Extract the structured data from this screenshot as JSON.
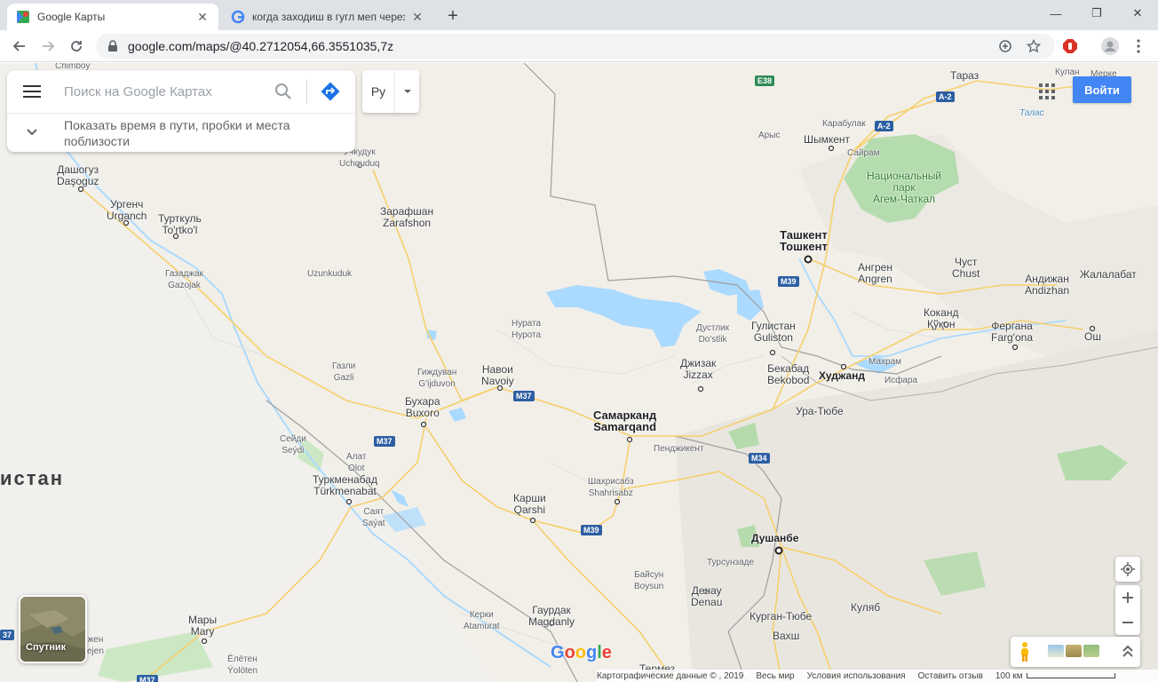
{
  "browser": {
    "tabs": [
      {
        "title": "Google Карты",
        "active": true
      },
      {
        "title": "когда заходиш в гугл меп через",
        "active": false
      }
    ],
    "new_tab": "+",
    "url": "google.com/maps/@40.2712054,66.3551035,7z",
    "window_controls": {
      "minimize": "—",
      "restore": "❐",
      "close": "✕"
    }
  },
  "search": {
    "placeholder": "Поиск на Google Картах",
    "nearby_text": "Показать время в пути, пробки и места поблизости"
  },
  "language": {
    "label": "Ру"
  },
  "header": {
    "signin": "Войти"
  },
  "satellite": {
    "label": "Спутник"
  },
  "logo": "Google",
  "footer": {
    "map_data": "Картографические данные ©  , 2019",
    "world": "Весь мир",
    "terms": "Условия использования",
    "feedback": "Оставить отзыв",
    "scale": "100 км"
  },
  "map": {
    "country_partial": "истан",
    "cities": [
      {
        "name": "Chimboy",
        "lines": [
          "Chimboy"
        ]
      },
      {
        "name": "Dashoguz",
        "lines": [
          "Дашогуз",
          "Daşoguz"
        ]
      },
      {
        "name": "Urgench",
        "lines": [
          "Ургенч",
          "Urganch"
        ]
      },
      {
        "name": "Turtkul",
        "lines": [
          "Турткуль",
          "To'rtko'l"
        ]
      },
      {
        "name": "Gazojak",
        "lines": [
          "Газаджак",
          "Gazojak"
        ]
      },
      {
        "name": "Uchquduq",
        "lines": [
          "Учкудук",
          "Uchquduq"
        ]
      },
      {
        "name": "Zarafshon",
        "lines": [
          "Зарафшан",
          "Zarafshon"
        ]
      },
      {
        "name": "Uzunkuduk",
        "lines": [
          "Uzunkuduk"
        ]
      },
      {
        "name": "Nurota",
        "lines": [
          "Нурата",
          "Нурота"
        ]
      },
      {
        "name": "Gazli",
        "lines": [
          "Газли",
          "Gazli"
        ]
      },
      {
        "name": "Gijduvan",
        "lines": [
          "Гиждуван",
          "G'ijduvon"
        ]
      },
      {
        "name": "Navoiy",
        "lines": [
          "Навои",
          "Navoiy"
        ]
      },
      {
        "name": "Bukhara",
        "lines": [
          "Бухара",
          "Buxoro"
        ]
      },
      {
        "name": "Seydi",
        "lines": [
          "Сейди",
          "Seýdi"
        ]
      },
      {
        "name": "Olot",
        "lines": [
          "Алат",
          "Olot"
        ]
      },
      {
        "name": "Turkmenabat",
        "lines": [
          "Туркменабад",
          "Türkmenabat"
        ]
      },
      {
        "name": "Sayat",
        "lines": [
          "Саят",
          "Saýat"
        ]
      },
      {
        "name": "Samarkand",
        "lines": [
          "Самарканд",
          "Samarqand"
        ]
      },
      {
        "name": "Penjikent",
        "lines": [
          "Пенджикент"
        ]
      },
      {
        "name": "Shahrisabz",
        "lines": [
          "Шахрисабз",
          "Shahrisabz"
        ]
      },
      {
        "name": "Karshi",
        "lines": [
          "Карши",
          "Qarshi"
        ]
      },
      {
        "name": "Jizzax",
        "lines": [
          "Джизак",
          "Jizzax"
        ]
      },
      {
        "name": "Dustlik",
        "lines": [
          "Дустлик",
          "Do'stlik"
        ]
      },
      {
        "name": "Guliston",
        "lines": [
          "Гулистан",
          "Guliston"
        ]
      },
      {
        "name": "Bekabad",
        "lines": [
          "Бекабад",
          "Bekobod"
        ]
      },
      {
        "name": "Khujand",
        "lines": [
          "Худжанд"
        ]
      },
      {
        "name": "Ura-Tyube",
        "lines": [
          "Ура-Тюбе"
        ]
      },
      {
        "name": "Tashkent",
        "lines": [
          "Ташкент",
          "Тошкент"
        ]
      },
      {
        "name": "Angren",
        "lines": [
          "Ангрен",
          "Angren"
        ]
      },
      {
        "name": "Chust",
        "lines": [
          "Чуст",
          "Chust"
        ]
      },
      {
        "name": "Andijan",
        "lines": [
          "Андижан",
          "Andizhan"
        ]
      },
      {
        "name": "Jalalabad",
        "lines": [
          "Жалалабат"
        ]
      },
      {
        "name": "Kokand",
        "lines": [
          "Коканд",
          "Қўқон"
        ]
      },
      {
        "name": "Fergana",
        "lines": [
          "Фергана",
          "Farg'ona"
        ]
      },
      {
        "name": "Osh",
        "lines": [
          "Ош"
        ]
      },
      {
        "name": "Isfara",
        "lines": [
          "Исфара"
        ]
      },
      {
        "name": "Makhram",
        "lines": [
          "Махрам"
        ]
      },
      {
        "name": "Shymkent",
        "lines": [
          "Шымкент"
        ]
      },
      {
        "name": "Karabulak",
        "lines": [
          "Карабулак"
        ]
      },
      {
        "name": "Arys",
        "lines": [
          "Арыс"
        ]
      },
      {
        "name": "Sairam",
        "lines": [
          "Сайрам"
        ]
      },
      {
        "name": "Taraz",
        "lines": [
          "Тараз"
        ]
      },
      {
        "name": "Kulan",
        "lines": [
          "Кулан"
        ]
      },
      {
        "name": "Merke",
        "lines": [
          "Мерке"
        ]
      },
      {
        "name": "Talas",
        "lines": [
          "Талас"
        ]
      },
      {
        "name": "Dushanbe",
        "lines": [
          "Душанбе"
        ]
      },
      {
        "name": "Tursunzade",
        "lines": [
          "Турсунзаде"
        ]
      },
      {
        "name": "Baysun",
        "lines": [
          "Байсун",
          "Boysun"
        ]
      },
      {
        "name": "Denau",
        "lines": [
          "Денау",
          "Denau"
        ]
      },
      {
        "name": "Kurgan-Tyube",
        "lines": [
          "Курган-Тюбе"
        ]
      },
      {
        "name": "Vakhsh",
        "lines": [
          "Вахш"
        ]
      },
      {
        "name": "Kulyab",
        "lines": [
          "Куляб"
        ]
      },
      {
        "name": "Termez",
        "lines": [
          "Термез"
        ]
      },
      {
        "name": "Guardak",
        "lines": [
          "Гаурдак",
          "Magdanly"
        ]
      },
      {
        "name": "Kerki",
        "lines": [
          "Керки",
          "Atamurat"
        ]
      },
      {
        "name": "Mary",
        "lines": [
          "Мары",
          "Mary"
        ]
      },
      {
        "name": "Yolotan",
        "lines": [
          "Ёлётен",
          "Ýolöten"
        ]
      },
      {
        "name": "Bayramaly",
        "lines": [
          "жен",
          "ejen"
        ]
      }
    ],
    "park": [
      "Национальный",
      "парк",
      "Агем-Чаткал"
    ],
    "roads": [
      "E38",
      "A-2",
      "A-2",
      "M39",
      "M37",
      "M37",
      "M34",
      "M39",
      "M37",
      "37"
    ]
  },
  "colors": {
    "map_land": "#f2efe9",
    "water": "#aadaff",
    "park": "#a8d8a0",
    "road": "#f7cf6a",
    "signin": "#4285f4"
  }
}
